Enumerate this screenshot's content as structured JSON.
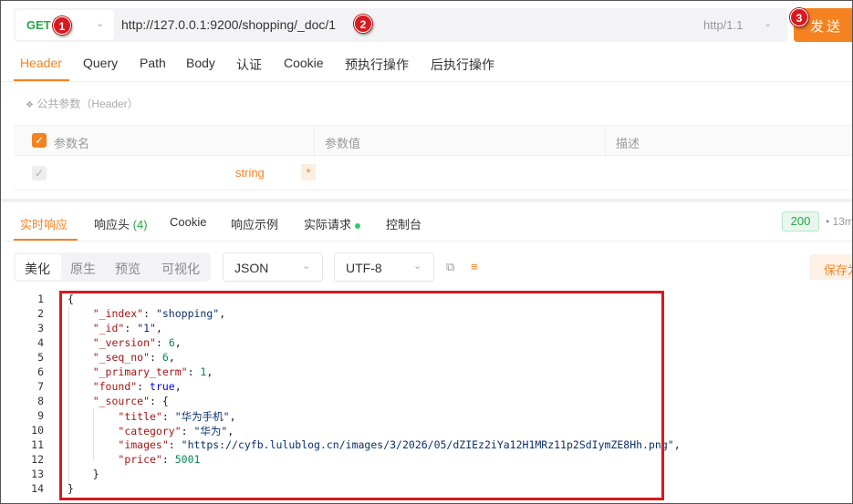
{
  "request": {
    "method": "GET",
    "url": "http://127.0.0.1:9200/shopping/_doc/1",
    "protocol": "http/1.1",
    "send_label": "发送",
    "badges": [
      "1",
      "2",
      "3"
    ]
  },
  "request_tabs": [
    "Header",
    "Query",
    "Path",
    "Body",
    "认证",
    "Cookie",
    "预执行操作",
    "后执行操作"
  ],
  "params": {
    "section_label": "公共参数（Header）",
    "columns": [
      "参数名",
      "参数值",
      "描述"
    ],
    "row": {
      "type": "string",
      "required": "*"
    }
  },
  "response_tabs": {
    "realtime": "实时响应",
    "headers_label": "响应头",
    "headers_count": "(4)",
    "cookie": "Cookie",
    "example": "响应示例",
    "actual": "实际请求",
    "console": "控制台"
  },
  "status": {
    "code": "200",
    "time": "13m"
  },
  "viewer": {
    "modes": [
      "美化",
      "原生",
      "预览",
      "可视化"
    ],
    "format": "JSON",
    "encoding": "UTF-8",
    "save_label": "保存为"
  },
  "code_lines": [
    {
      "n": "1",
      "text": "{"
    },
    {
      "n": "2",
      "text": "    \"_index\": \"shopping\","
    },
    {
      "n": "3",
      "text": "    \"_id\": \"1\","
    },
    {
      "n": "4",
      "text": "    \"_version\": 6,"
    },
    {
      "n": "5",
      "text": "    \"_seq_no\": 6,"
    },
    {
      "n": "6",
      "text": "    \"_primary_term\": 1,"
    },
    {
      "n": "7",
      "text": "    \"found\": true,"
    },
    {
      "n": "8",
      "text": "    \"_source\": {"
    },
    {
      "n": "9",
      "text": "        \"title\": \"华为手机\","
    },
    {
      "n": "10",
      "text": "        \"category\": \"华为\","
    },
    {
      "n": "11",
      "text": "        \"images\": \"https://cyfb.lulublog.cn/images/3/2026/05/dZIEz2iYa12H1MRz11p2SdIymZE8Hh.png\","
    },
    {
      "n": "12",
      "text": "        \"price\": 5001"
    },
    {
      "n": "13",
      "text": "    }"
    },
    {
      "n": "14",
      "text": "}"
    }
  ],
  "colors": {
    "accent": "#f58220",
    "success": "#28a745",
    "annotation": "#d8191e"
  }
}
